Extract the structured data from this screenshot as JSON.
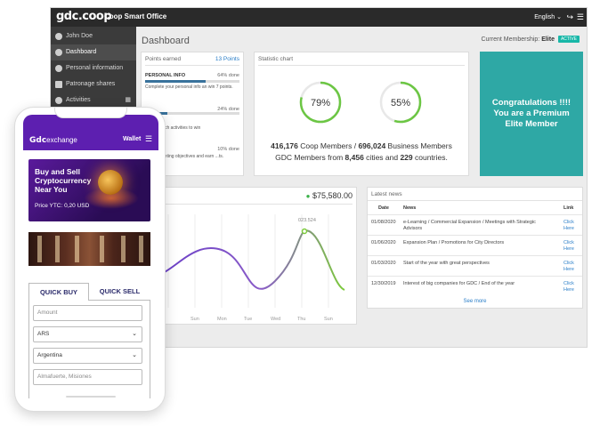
{
  "topbar": {
    "logo": "gdc.coop",
    "title": "Coop Smart Office",
    "language": "English"
  },
  "sidebar": {
    "items": [
      {
        "label": "John Doe",
        "icon": "user-icon"
      },
      {
        "label": "Dashboard",
        "icon": "dashboard-icon"
      },
      {
        "label": "Personal information",
        "icon": "person-icon"
      },
      {
        "label": "Patronage shares",
        "icon": "shares-icon"
      },
      {
        "label": "Activities",
        "icon": "clock-icon"
      }
    ]
  },
  "page": {
    "title": "Dashboard",
    "membership_label": "Current Membership:",
    "membership_level": "Elite",
    "membership_badge": "ACTIVE"
  },
  "points": {
    "title": "Points earned",
    "total": "13 Points",
    "rows": [
      {
        "name": "PERSONAL INFO",
        "done": "64% done",
        "progress": 0.64,
        "desc": "Complete your personal info an win 7 points."
      },
      {
        "name": "",
        "done": "24% done",
        "progress": 0.24,
        "desc": ""
      },
      {
        "name": "",
        "done": "",
        "progress": 0.0,
        "desc": "ll pre-launch activities to win"
      },
      {
        "name": "TING",
        "done": "10% done",
        "progress": 0.1,
        "desc": "e all marketing objectives and earn ...ts."
      }
    ]
  },
  "statistic": {
    "title": "Statistic chart",
    "gauges": [
      {
        "value": 0.79,
        "label": "79%"
      },
      {
        "value": 0.55,
        "label": "55%"
      }
    ],
    "line1_a": "416,176",
    "line1_b": " Coop Members / ",
    "line1_c": "696,024",
    "line1_d": " Business Members",
    "line2_a": "GDC Members from ",
    "line2_b": "8,456",
    "line2_c": " cities and ",
    "line2_d": "229",
    "line2_e": " countries."
  },
  "congrats": {
    "line1": "Congratulations !!!!",
    "line2": "You are a Premium",
    "line3": "Elite Member"
  },
  "earnings": {
    "title_fragment": "e",
    "amount": "$75,580.00",
    "tooltip": "023.524",
    "days": [
      "Sun",
      "Mon",
      "Tue",
      "Wed",
      "Thu",
      "Sun"
    ],
    "colors": {
      "line_start": "#6a3fc7",
      "line_end": "#7ccb3a"
    }
  },
  "news": {
    "title": "Latest news",
    "headers": {
      "date": "Date",
      "news": "News",
      "link": "Link"
    },
    "rows": [
      {
        "date": "01/08/2020",
        "text": "e-Learning / Commercial Expansion / Meetings with Strategic Advisors",
        "link": "Click Here"
      },
      {
        "date": "01/06/2020",
        "text": "Expansion Plan / Promotions for City Directors",
        "link": "Click Here"
      },
      {
        "date": "01/03/2020",
        "text": "Start of the year with great perspectives",
        "link": "Click Here"
      },
      {
        "date": "12/30/2019",
        "text": "Interest of big companies for GDC / End of the year",
        "link": "Click Here"
      }
    ],
    "see_more": "See more"
  },
  "phone": {
    "logo_mark": "Gdc",
    "logo_text": "exchange",
    "wallet": "Wallet",
    "promo": {
      "title_l1": "Buy and Sell",
      "title_l2": "Cryptocurrency",
      "title_l3": "Near You",
      "price": "Price YTC: 0,20 USD"
    },
    "tabs": {
      "buy": "QUICK BUY",
      "sell": "QUICK SELL"
    },
    "fields": {
      "amount_placeholder": "Amount",
      "currency": "ARS",
      "country": "Argentina",
      "city": "Almafuerte, Misiones"
    }
  },
  "colors": {
    "accent_purple": "#5d1fb0",
    "teal": "#2ea8a5",
    "green": "#3cb14a",
    "link_blue": "#2a7ec8"
  }
}
